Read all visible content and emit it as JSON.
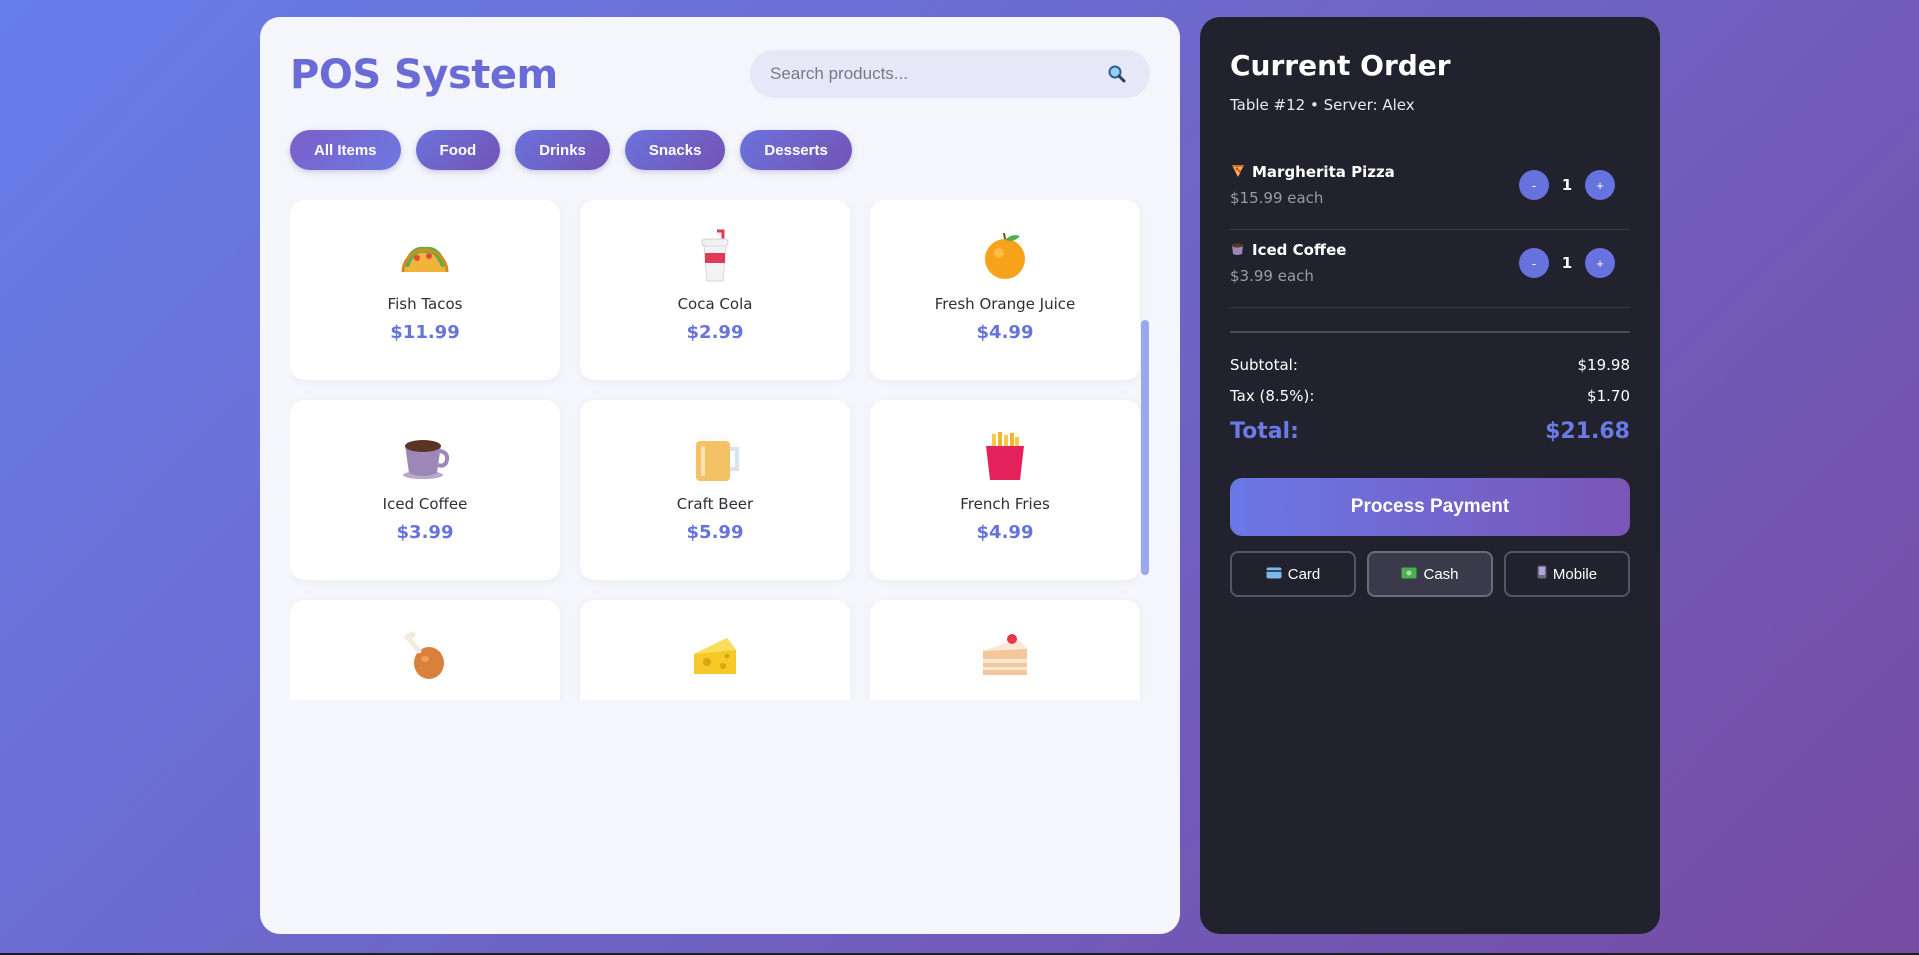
{
  "app": {
    "title": "POS System"
  },
  "search": {
    "placeholder": "Search products...",
    "value": ""
  },
  "categories": [
    {
      "label": "All Items",
      "active": true
    },
    {
      "label": "Food",
      "active": false
    },
    {
      "label": "Drinks",
      "active": false
    },
    {
      "label": "Snacks",
      "active": false
    },
    {
      "label": "Desserts",
      "active": false
    }
  ],
  "products": [
    {
      "name": "Fish Tacos",
      "price": "$11.99",
      "icon": "taco-icon"
    },
    {
      "name": "Coca Cola",
      "price": "$2.99",
      "icon": "soda-cup-icon"
    },
    {
      "name": "Fresh Orange Juice",
      "price": "$4.99",
      "icon": "orange-icon"
    },
    {
      "name": "Iced Coffee",
      "price": "$3.99",
      "icon": "coffee-icon"
    },
    {
      "name": "Craft Beer",
      "price": "$5.99",
      "icon": "beer-mug-icon"
    },
    {
      "name": "French Fries",
      "price": "$4.99",
      "icon": "fries-icon"
    },
    {
      "name": "",
      "price": "",
      "icon": "chicken-leg-icon"
    },
    {
      "name": "",
      "price": "",
      "icon": "cheese-icon"
    },
    {
      "name": "",
      "price": "",
      "icon": "cake-slice-icon"
    }
  ],
  "order": {
    "title": "Current Order",
    "meta": "Table #12 • Server: Alex",
    "items": [
      {
        "icon": "pizza-icon",
        "name": "Margherita Pizza",
        "each": "$15.99 each",
        "qty": "1",
        "minus": "-",
        "plus": "+"
      },
      {
        "icon": "coffee-icon",
        "name": "Iced Coffee",
        "each": "$3.99 each",
        "qty": "1",
        "minus": "-",
        "plus": "+"
      }
    ],
    "subtotal_label": "Subtotal:",
    "subtotal": "$19.98",
    "tax_label": "Tax (8.5%):",
    "tax": "$1.70",
    "total_label": "Total:",
    "total": "$21.68",
    "pay_label": "Process Payment",
    "methods": [
      {
        "label": "Card",
        "icon": "credit-card-icon",
        "selected": false
      },
      {
        "label": "Cash",
        "icon": "cash-icon",
        "selected": true
      },
      {
        "label": "Mobile",
        "icon": "mobile-phone-icon",
        "selected": false
      }
    ]
  },
  "colors": {
    "accent": "#6673dc",
    "background_start": "#667eea",
    "background_end": "#764ba2",
    "order_panel": "#22222e"
  }
}
